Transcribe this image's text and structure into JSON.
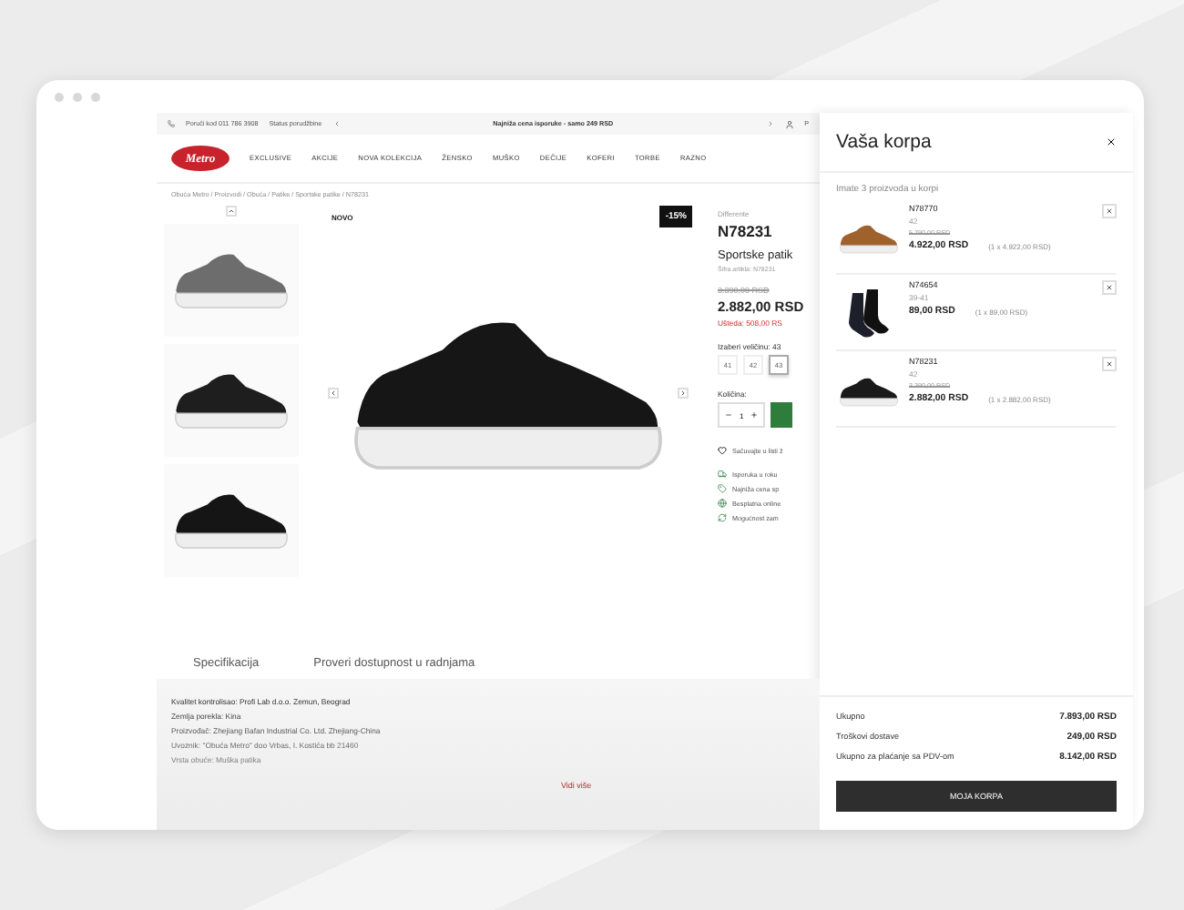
{
  "top_bar": {
    "phone": "Poruči kod 011 786 3908",
    "order_status": "Status porudžbine",
    "promo": "Najniža cena isporuke - samo 249 RSD",
    "account": "P"
  },
  "nav": {
    "logo": "Metro",
    "items": [
      "EXCLUSIVE",
      "AKCIJE",
      "NOVA KOLEKCIJA",
      "ŽENSKO",
      "MUŠKO",
      "DEČIJE",
      "KOFERI",
      "TORBE",
      "RAZNO"
    ]
  },
  "breadcrumb": "Obuća Metro / Proizvodi / Obuća / Patike / Sportske patike / N78231",
  "product": {
    "badge_new": "NOVO",
    "discount": "-15%",
    "brand": "Differente",
    "code": "N78231",
    "name": "Sportske patik",
    "sku": "Šifra artikla: N78231",
    "old_price": "3.390,00 RSD",
    "price": "2.882,00 RSD",
    "saving": "Ušteda: 508,00 RS",
    "size_label": "Izaberi veličinu: 43",
    "sizes": [
      {
        "label": "41",
        "selected": false
      },
      {
        "label": "42",
        "selected": false
      },
      {
        "label": "43",
        "selected": true
      }
    ],
    "quantity_label": "Količina:",
    "quantity": "1",
    "wishlist": "Sačuvajte u listi ž",
    "features": [
      "Isporuka u roku",
      "Najniža cena sp",
      "Besplatna online",
      "Mogućnost zam"
    ]
  },
  "tabs": [
    "Specifikacija",
    "Proveri dostupnost u radnjama"
  ],
  "specs": [
    "Kvalitet kontrolisao: Profi Lab d.o.o. Zemun, Beograd",
    "Zemlja porekla: Kina",
    "Proizvođač: Zhejiang Bafan Industrial Co. Ltd. Zhejiang-China",
    "Uvoznik: \"Obuća Metro\" doo Vrbas, I. Kostića bb 21460",
    "Vrsta obuće: Muška patika"
  ],
  "more_link": "Vidi više",
  "cart": {
    "title": "Vaša korpa",
    "summary": "Imate 3 proizvoda u korpi",
    "items": [
      {
        "code": "N78770",
        "size": "42",
        "old_price": "5.790,00 RSD",
        "price": "4.922,00 RSD",
        "unit": "(1 x 4.922,00 RSD)"
      },
      {
        "code": "N74654",
        "size": "39-41",
        "price": "89,00 RSD",
        "unit": "(1 x 89,00 RSD)"
      },
      {
        "code": "N78231",
        "size": "42",
        "old_price": "3.390,00 RSD",
        "price": "2.882,00 RSD",
        "unit": "(1 x 2.882,00 RSD)"
      }
    ],
    "totals": [
      {
        "label": "Ukupno",
        "value": "7.893,00 RSD"
      },
      {
        "label": "Troškovi dostave",
        "value": "249,00 RSD"
      },
      {
        "label": "Ukupno za plaćanje sa PDV-om",
        "value": "8.142,00 RSD"
      }
    ],
    "button": "MOJA KORPA"
  }
}
